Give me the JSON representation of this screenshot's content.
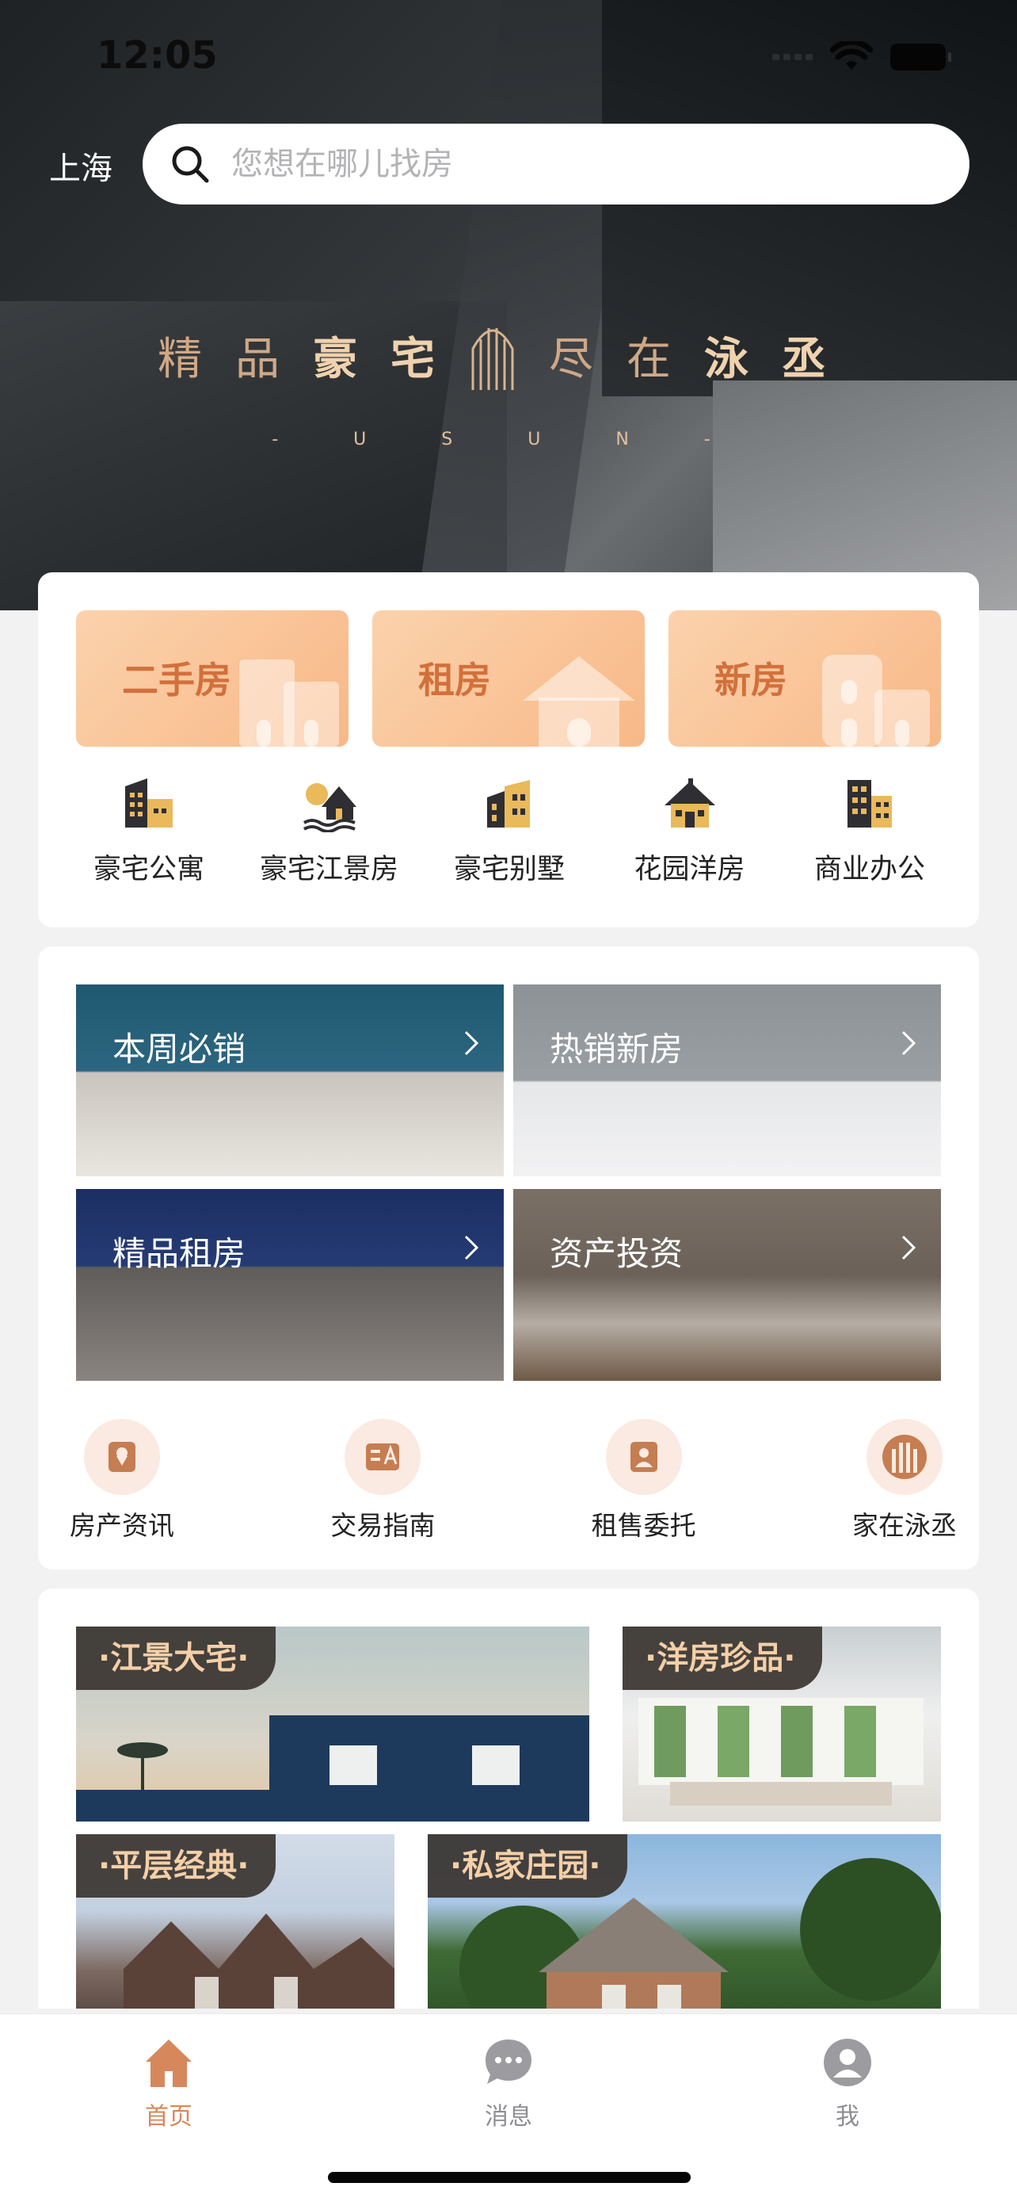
{
  "status_bar": {
    "time": "12:05"
  },
  "header": {
    "city": "上海",
    "search_placeholder": "您想在哪儿找房"
  },
  "hero": {
    "slogan_left_thin": "精品",
    "slogan_left_bold": "豪宅",
    "slogan_right_thin": "尽在",
    "slogan_right_bold": "泳丞",
    "brand_spaced": "- U S U N -"
  },
  "main_categories": [
    {
      "label": "二手房"
    },
    {
      "label": "租房"
    },
    {
      "label": "新房"
    }
  ],
  "property_types": [
    {
      "label": "豪宅公寓",
      "icon": "apartment-building-icon"
    },
    {
      "label": "豪宅江景房",
      "icon": "riverside-house-icon"
    },
    {
      "label": "豪宅别墅",
      "icon": "villa-icon"
    },
    {
      "label": "花园洋房",
      "icon": "garden-house-icon"
    },
    {
      "label": "商业办公",
      "icon": "office-building-icon"
    }
  ],
  "promo_tiles": [
    {
      "label": "本周必销"
    },
    {
      "label": "热销新房"
    },
    {
      "label": "精品租房"
    },
    {
      "label": "资产投资"
    }
  ],
  "shortcuts": [
    {
      "label": "房产资讯",
      "icon": "location-pin-icon"
    },
    {
      "label": "交易指南",
      "icon": "guide-book-icon"
    },
    {
      "label": "租售委托",
      "icon": "person-card-icon"
    },
    {
      "label": "家在泳丞",
      "icon": "brand-logo-icon"
    }
  ],
  "featured": [
    {
      "label": "·江景大宅·"
    },
    {
      "label": "·洋房珍品·"
    },
    {
      "label": "·平层经典·"
    },
    {
      "label": "·私家庄园·"
    }
  ],
  "tabbar": [
    {
      "label": "首页",
      "icon": "home-icon",
      "active": true
    },
    {
      "label": "消息",
      "icon": "message-icon",
      "active": false
    },
    {
      "label": "我",
      "icon": "profile-icon",
      "active": false
    }
  ],
  "colors": {
    "accent": "#d6885c",
    "tile_gradient_start": "#fbd2ac",
    "tile_gradient_end": "#f8b887",
    "gold_text": "#e3bf98"
  }
}
